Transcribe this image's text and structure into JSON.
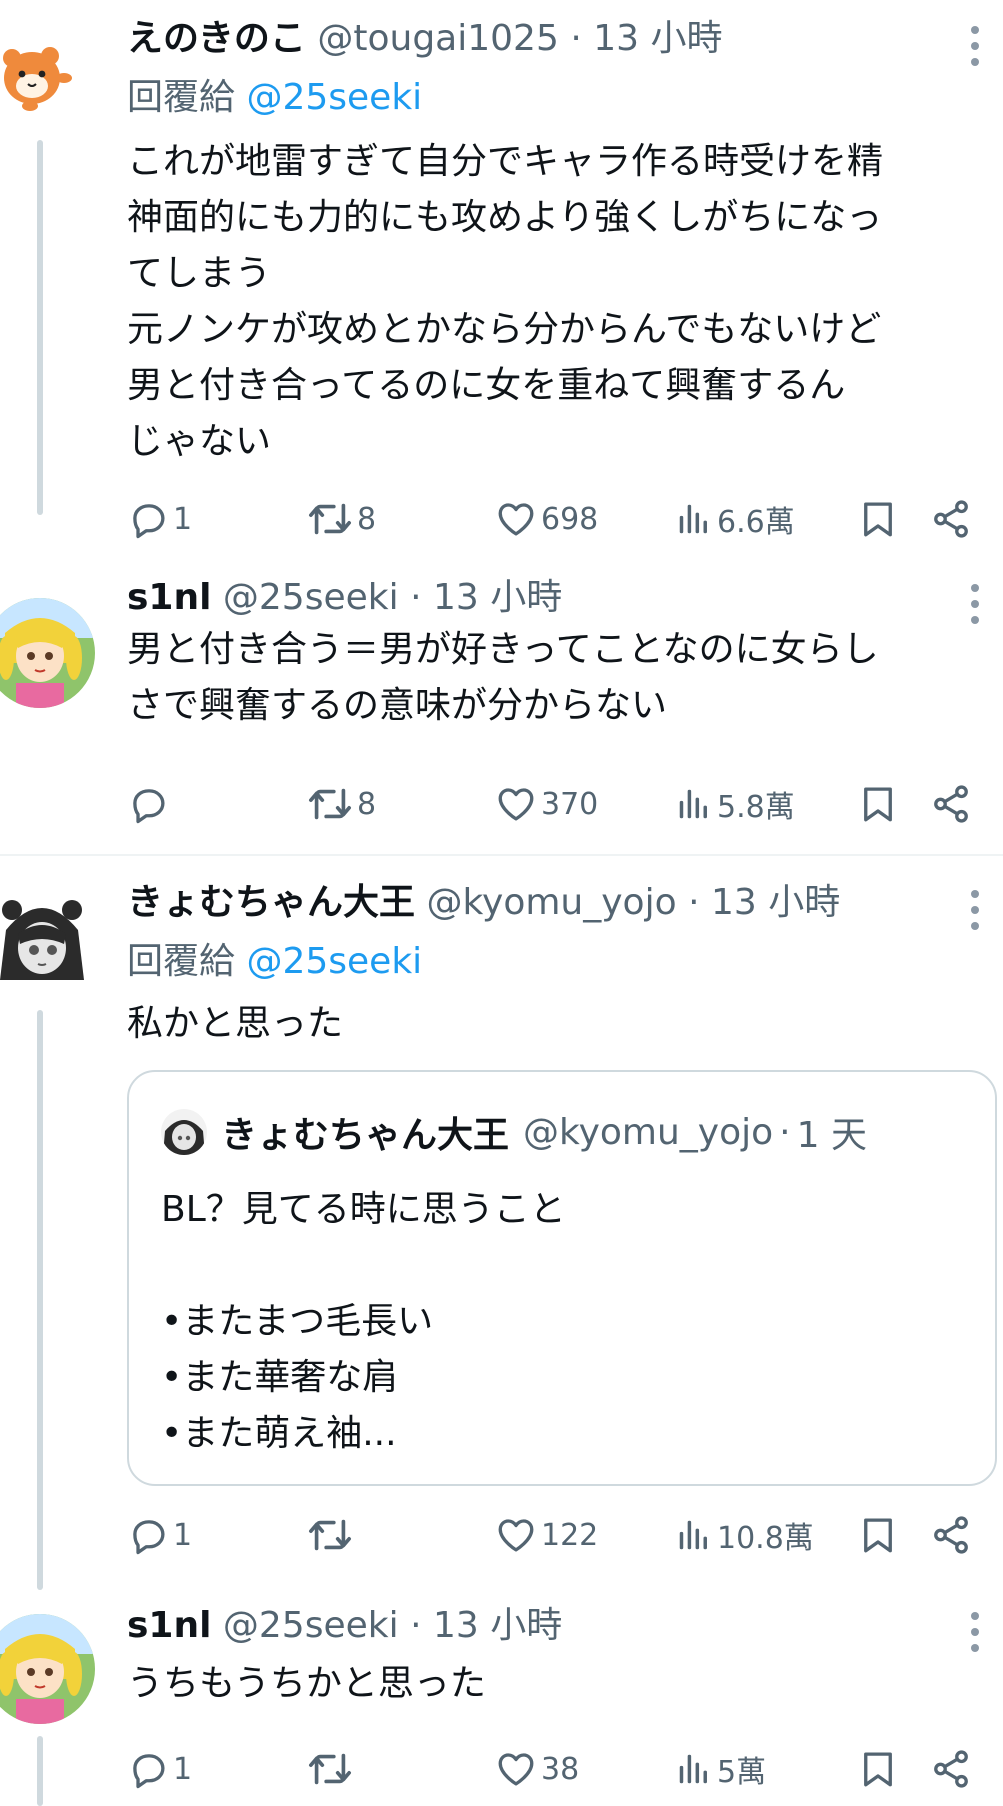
{
  "tweets": [
    {
      "name": "えのきのこ",
      "handle": "@tougai1025",
      "dot": "·",
      "time": "13 小時",
      "reply_prefix": "回覆給",
      "reply_mention": "@25seeki",
      "text": "これが地雷すぎて自分でキャラ作る時受けを精\n神面的にも力的にも攻めより強くしがちになっ\nてしまう\n元ノンケが攻めとかなら分からんでもないけど\n男と付き合ってるのに女を重ねて興奮するん\nじゃない",
      "replies": "1",
      "retweets": "8",
      "likes": "698",
      "views": "6.6萬",
      "avatar": "hamster-avatar"
    },
    {
      "name": "s1nl",
      "handle": "@25seeki",
      "dot": "·",
      "time": "13 小時",
      "text": "男と付き合う＝男が好きってことなのに女らし\nさで興奮するの意味が分からない",
      "replies": "",
      "retweets": "8",
      "likes": "370",
      "views": "5.8萬",
      "avatar": "blonde-girl-avatar"
    },
    {
      "name": "きょむちゃん大王",
      "handle": "@kyomu_yojo",
      "dot": "·",
      "time": "13 小時",
      "reply_prefix": "回覆給",
      "reply_mention": "@25seeki",
      "text": "私かと思った",
      "quote": {
        "name": "きょむちゃん大王",
        "handle": "@kyomu_yojo",
        "dot": "·",
        "time": "1 天",
        "text": "BL？見てる時に思うこと\n\n•またまつ毛長い\n•また華奢な肩\n•また萌え袖..."
      },
      "replies": "1",
      "retweets": "",
      "likes": "122",
      "views": "10.8萬",
      "avatar": "monochrome-girl-avatar"
    },
    {
      "name": "s1nl",
      "handle": "@25seeki",
      "dot": "·",
      "time": "13 小時",
      "text": "うちもうちかと思った",
      "replies": "1",
      "retweets": "",
      "likes": "38",
      "views": "5萬",
      "avatar": "blonde-girl-avatar"
    }
  ],
  "colors": {
    "text": "#0f1419",
    "secondary": "#536471",
    "link": "#1d9bf0",
    "border": "#cfd9de"
  }
}
